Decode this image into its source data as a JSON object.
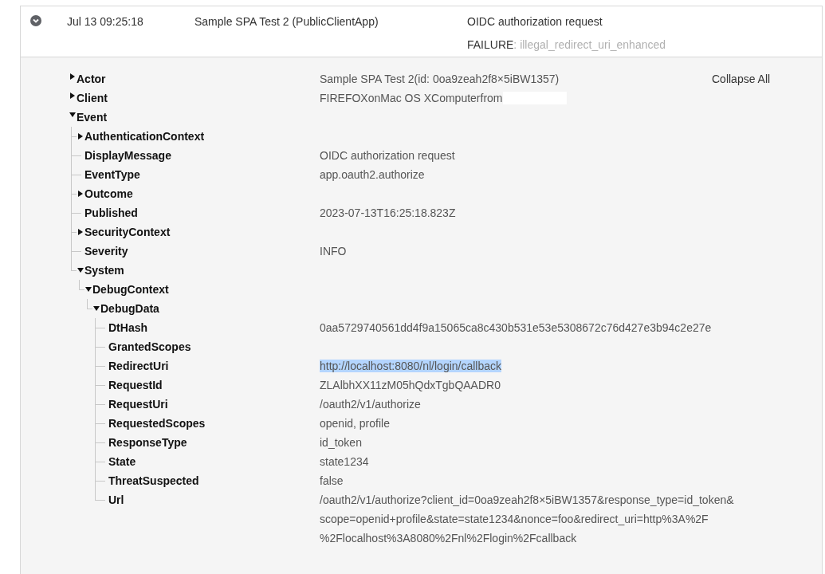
{
  "event_row": {
    "expanded": true,
    "time": "Jul 13 09:25:18",
    "actor": "Sample SPA Test 2 (PublicClientApp)",
    "message": "OIDC authorization request",
    "outcome_result": "FAILURE",
    "outcome_reason": ": illegal_redirect_uri_enhanced"
  },
  "collapse_all": "Collapse All",
  "tree": [
    {
      "label": "Actor",
      "expanded": false,
      "value": "Sample SPA Test 2(id: 0oa9zeah2f8×5iBW1357)",
      "highlighted": false
    },
    {
      "label": "Client",
      "expanded": false,
      "value": "FIREFOXonMac OS XComputerfrom",
      "redacted": true,
      "highlighted": false
    },
    {
      "label": "Event",
      "expanded": true,
      "children": [
        {
          "label": "AuthenticationContext",
          "expanded": false
        },
        {
          "label": "DisplayMessage",
          "value": "OIDC authorization request",
          "highlighted": false
        },
        {
          "label": "EventType",
          "value": "app.oauth2.authorize",
          "highlighted": false
        },
        {
          "label": "Outcome",
          "expanded": false
        },
        {
          "label": "Published",
          "value": "2023-07-13T16:25:18.823Z",
          "highlighted": false
        },
        {
          "label": "SecurityContext",
          "expanded": false
        },
        {
          "label": "Severity",
          "value": "INFO",
          "highlighted": false
        },
        {
          "label": "System",
          "expanded": true,
          "children": [
            {
              "label": "DebugContext",
              "expanded": true,
              "children": [
                {
                  "label": "DebugData",
                  "expanded": true,
                  "children": [
                    {
                      "label": "DtHash",
                      "value": "0aa5729740561dd4f9a15065ca8c430b531e53e5308672c76d427e3b94c2e27e",
                      "highlighted": false
                    },
                    {
                      "label": "GrantedScopes"
                    },
                    {
                      "label": "RedirectUri",
                      "value": "http://localhost:8080/nl/login/callback",
                      "highlighted": true
                    },
                    {
                      "label": "RequestId",
                      "value": "ZLAlbhXX11zM05hQdxTgbQAADR0",
                      "highlighted": false
                    },
                    {
                      "label": "RequestUri",
                      "value": "/oauth2/v1/authorize",
                      "highlighted": false
                    },
                    {
                      "label": "RequestedScopes",
                      "value": "openid, profile",
                      "highlighted": false
                    },
                    {
                      "label": "ResponseType",
                      "value": "id_token",
                      "highlighted": false
                    },
                    {
                      "label": "State",
                      "value": "state1234",
                      "highlighted": false
                    },
                    {
                      "label": "ThreatSuspected",
                      "value": "false",
                      "highlighted": false
                    },
                    {
                      "label": "Url",
                      "value": "/oauth2/v1/authorize?client_id=0oa9zeah2f8×5iBW1357&response_type=id_token&scope=openid+profile&state=state1234&nonce=foo&redirect_uri=http%3A%2F%2Flocalhost%3A8080%2Fnl%2Flogin%2Fcallback",
                      "highlighted": false
                    }
                  ]
                }
              ]
            }
          ]
        }
      ]
    }
  ]
}
